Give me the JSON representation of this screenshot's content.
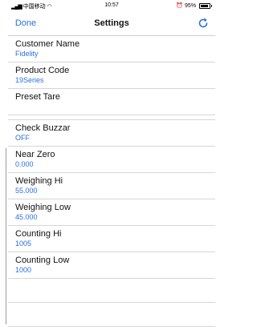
{
  "status_bar": {
    "carrier": "中国移动",
    "time": "10:57",
    "battery": "95%"
  },
  "nav": {
    "done_label": "Done",
    "title": "Settings",
    "refresh_icon": "refresh-icon"
  },
  "colors": {
    "accent": "#2b6fe0",
    "separator": "#d6d6d6"
  },
  "settings": [
    {
      "label": "Customer Name",
      "value": "Fidelity"
    },
    {
      "label": "Product Code",
      "value": "19Series"
    },
    {
      "label": "Preset Tare",
      "value": ""
    },
    {
      "label": "Check Buzzar",
      "value": "OFF"
    },
    {
      "label": "Near Zero",
      "value": "0.000"
    },
    {
      "label": "Weighing Hi",
      "value": "55.000"
    },
    {
      "label": "Weighing Low",
      "value": "45.000"
    },
    {
      "label": "Counting Hi",
      "value": "1005"
    },
    {
      "label": "Counting Low",
      "value": "1000"
    }
  ]
}
